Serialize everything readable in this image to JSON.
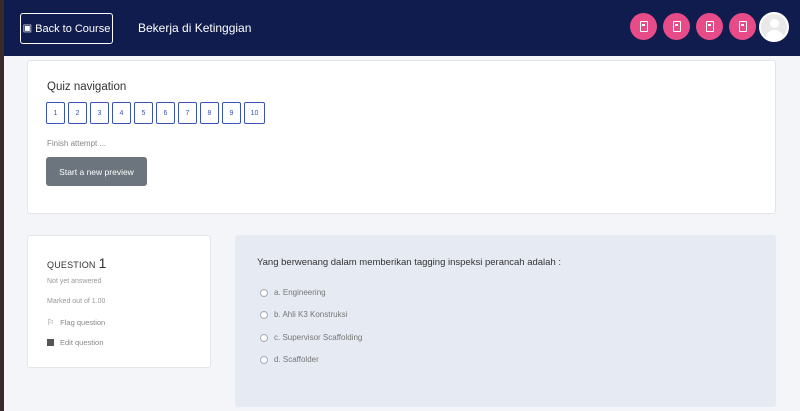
{
  "header": {
    "back_label": "Back to Course",
    "course_title": "Bekerja di Ketinggian",
    "nav_icons": [
      "page-icon",
      "page-icon",
      "page-icon",
      "page-icon"
    ],
    "accent_color": "#e84c88",
    "bar_color": "#0f1c4d"
  },
  "quiz_nav": {
    "title": "Quiz navigation",
    "questions": [
      "1",
      "2",
      "3",
      "4",
      "5",
      "6",
      "7",
      "8",
      "9",
      "10"
    ],
    "finish_label": "Finish attempt ...",
    "start_preview_label": "Start a new preview"
  },
  "question_info": {
    "label": "QUESTION",
    "number": "1",
    "status": "Not yet answered",
    "marks": "Marked out of 1.00",
    "flag_label": "Flag question",
    "edit_label": "Edit question"
  },
  "question": {
    "text": "Yang berwenang dalam memberikan tagging inspeksi perancah adalah :",
    "options": [
      "a. Engineering",
      "b. Ahli K3 Konstruksi",
      "c. Supervisor Scaffolding",
      "d. Scaffolder"
    ]
  }
}
